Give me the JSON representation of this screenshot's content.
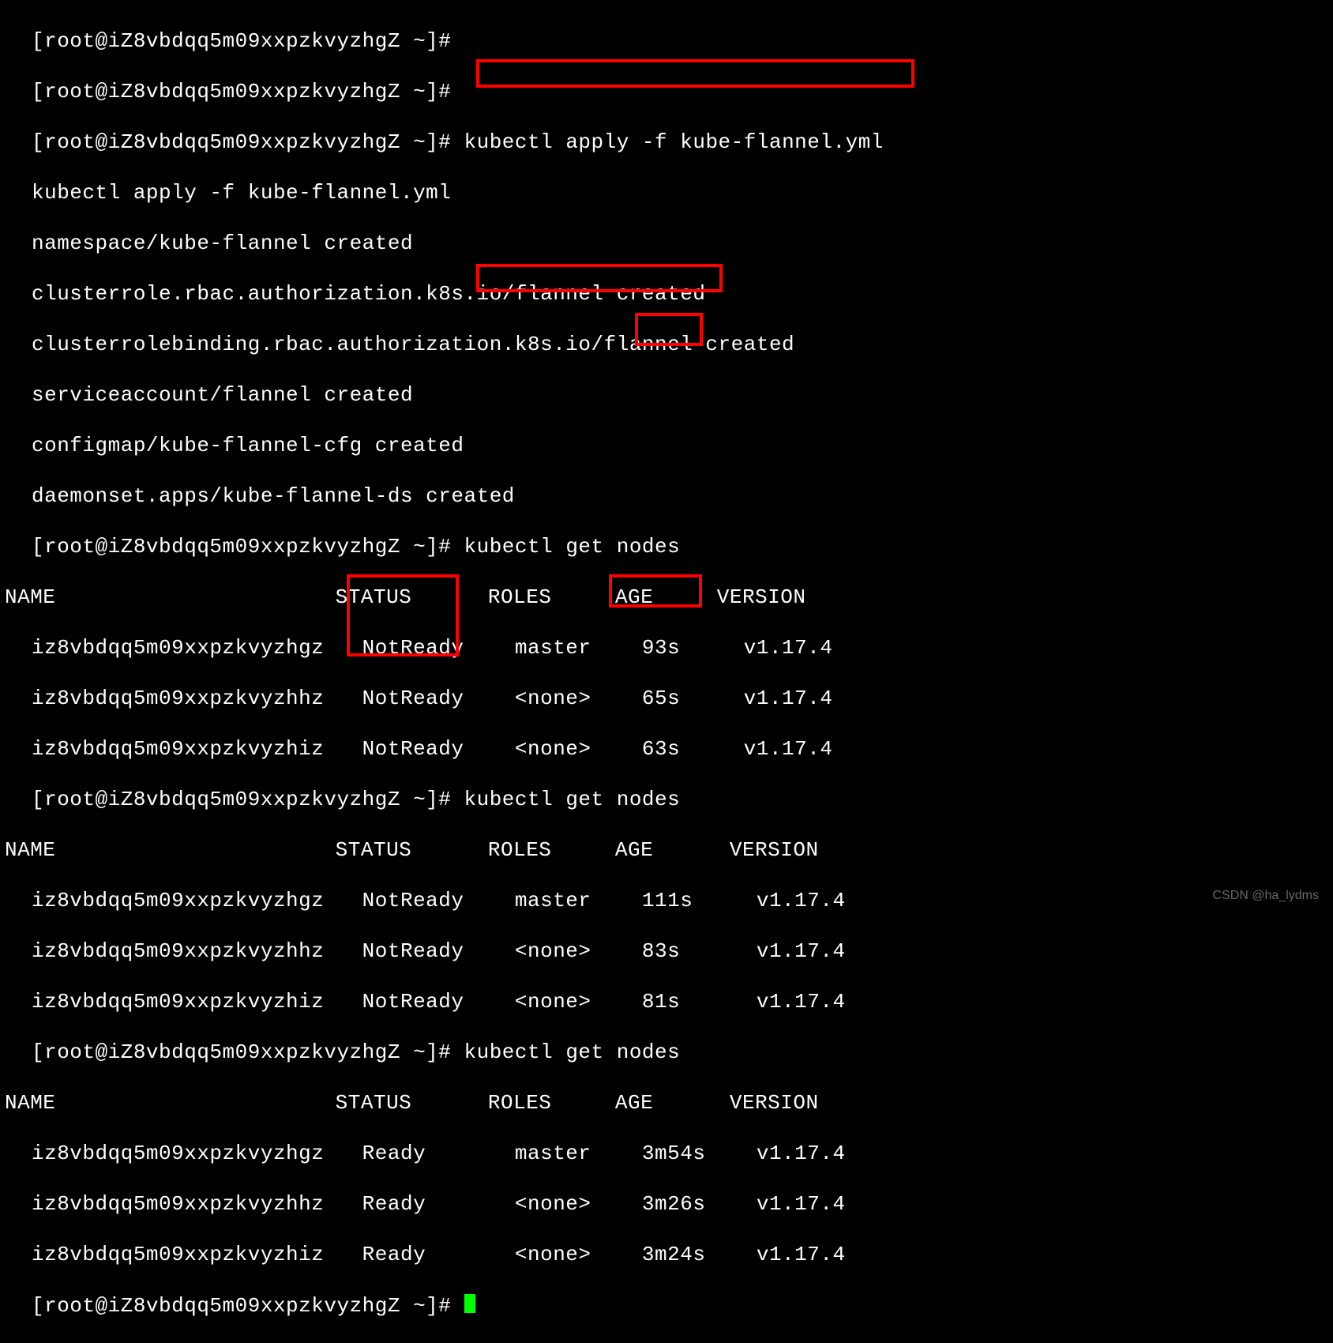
{
  "prompt_partial_top": "[root@iZ8vbdqq5m09xxpzkvyzhgZ ~]#",
  "prompt": "[root@iZ8vbdqq5m09xxpzkvyzhgZ ~]# ",
  "prompt_only": "[root@iZ8vbdqq5m09xxpzkvyzhgZ ~]#",
  "cmd_apply": "kubectl apply -f kube-flannel.yml",
  "apply_echo": "kubectl apply -f kube-flannel.yml",
  "apply_output": [
    "namespace/kube-flannel created",
    "clusterrole.rbac.authorization.k8s.io/flannel created",
    "clusterrolebinding.rbac.authorization.k8s.io/flannel created",
    "serviceaccount/flannel created",
    "configmap/kube-flannel-cfg created",
    "daemonset.apps/kube-flannel-ds created"
  ],
  "cmd_get_nodes": "kubectl get nodes",
  "tables": [
    {
      "header": {
        "name": "NAME",
        "status": "STATUS",
        "roles": "ROLES",
        "age": "AGE",
        "version": "VERSION"
      },
      "rows": [
        {
          "name": "iz8vbdqq5m09xxpzkvyzhgz",
          "status": "NotReady",
          "roles": "master",
          "age": "93s",
          "version": "v1.17.4"
        },
        {
          "name": "iz8vbdqq5m09xxpzkvyzhhz",
          "status": "NotReady",
          "roles": "<none>",
          "age": "65s",
          "version": "v1.17.4"
        },
        {
          "name": "iz8vbdqq5m09xxpzkvyzhiz",
          "status": "NotReady",
          "roles": "<none>",
          "age": "63s",
          "version": "v1.17.4"
        }
      ]
    },
    {
      "header": {
        "name": "NAME",
        "status": "STATUS",
        "roles": "ROLES",
        "age": "AGE",
        "version": "VERSION"
      },
      "rows": [
        {
          "name": "iz8vbdqq5m09xxpzkvyzhgz",
          "status": "NotReady",
          "roles": "master",
          "age": "111s",
          "version": "v1.17.4"
        },
        {
          "name": "iz8vbdqq5m09xxpzkvyzhhz",
          "status": "NotReady",
          "roles": "<none>",
          "age": "83s",
          "version": "v1.17.4"
        },
        {
          "name": "iz8vbdqq5m09xxpzkvyzhiz",
          "status": "NotReady",
          "roles": "<none>",
          "age": "81s",
          "version": "v1.17.4"
        }
      ]
    },
    {
      "header": {
        "name": "NAME",
        "status": "STATUS",
        "roles": "ROLES",
        "age": "AGE",
        "version": "VERSION"
      },
      "rows": [
        {
          "name": "iz8vbdqq5m09xxpzkvyzhgz",
          "status": "Ready",
          "roles": "master",
          "age": "3m54s",
          "version": "v1.17.4"
        },
        {
          "name": "iz8vbdqq5m09xxpzkvyzhhz",
          "status": "Ready",
          "roles": "<none>",
          "age": "3m26s",
          "version": "v1.17.4"
        },
        {
          "name": "iz8vbdqq5m09xxpzkvyzhiz",
          "status": "Ready",
          "roles": "<none>",
          "age": "3m24s",
          "version": "v1.17.4"
        }
      ]
    }
  ],
  "cols": {
    "name_w": 26,
    "status_w": 12,
    "roles_w": 10,
    "age_w": 8
  },
  "colsB": {
    "name_w": 26,
    "status_w": 12,
    "roles_w": 10,
    "age_w": 9
  },
  "watermark": "CSDN @ha_lydms"
}
